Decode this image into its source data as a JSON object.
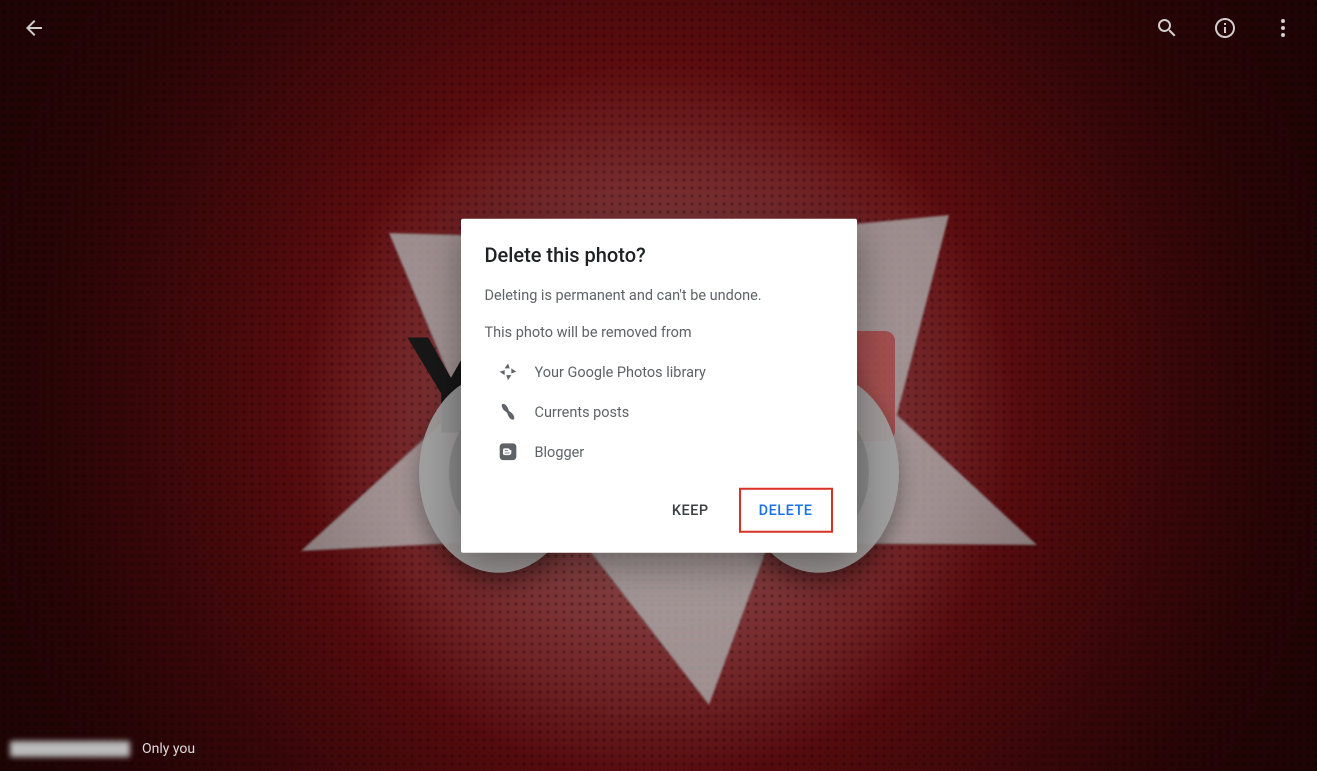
{
  "toolbar": {
    "back_icon": "arrow-back-icon",
    "zoom_icon": "zoom-icon",
    "info_icon": "info-icon",
    "more_icon": "more-vert-icon"
  },
  "dialog": {
    "title": "Delete this photo?",
    "line1": "Deleting is permanent and can't be undone.",
    "line2": "This photo will be removed from",
    "items": [
      {
        "icon": "photos-pinwheel-icon",
        "label": "Your Google Photos library"
      },
      {
        "icon": "currents-icon",
        "label": "Currents posts"
      },
      {
        "icon": "blogger-icon",
        "label": "Blogger"
      }
    ],
    "keep_label": "KEEP",
    "delete_label": "DELETE"
  },
  "footer": {
    "visibility_label": "Only you"
  }
}
